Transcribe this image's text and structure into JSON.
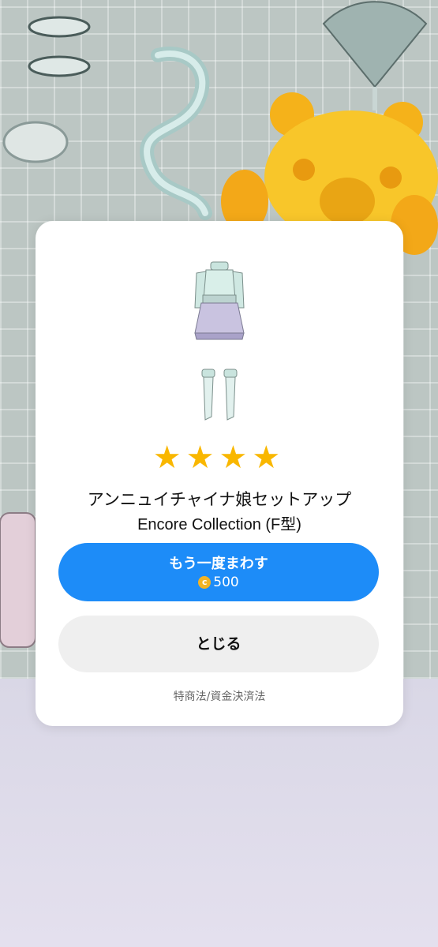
{
  "item": {
    "name": "アンニュイチャイナ娘セットアップ",
    "collection": "Encore Collection (F型)",
    "rarity_stars": 4
  },
  "buttons": {
    "spin_again_label": "もう一度まわす",
    "spin_again_cost": "500",
    "coin_icon": "coin-icon",
    "close_label": "とじる"
  },
  "legal_link": "特商法/資金決済法",
  "colors": {
    "primary_button": "#1d8cf8",
    "secondary_button": "#efefef",
    "star": "#f9b700",
    "coin": "#f3b425"
  }
}
